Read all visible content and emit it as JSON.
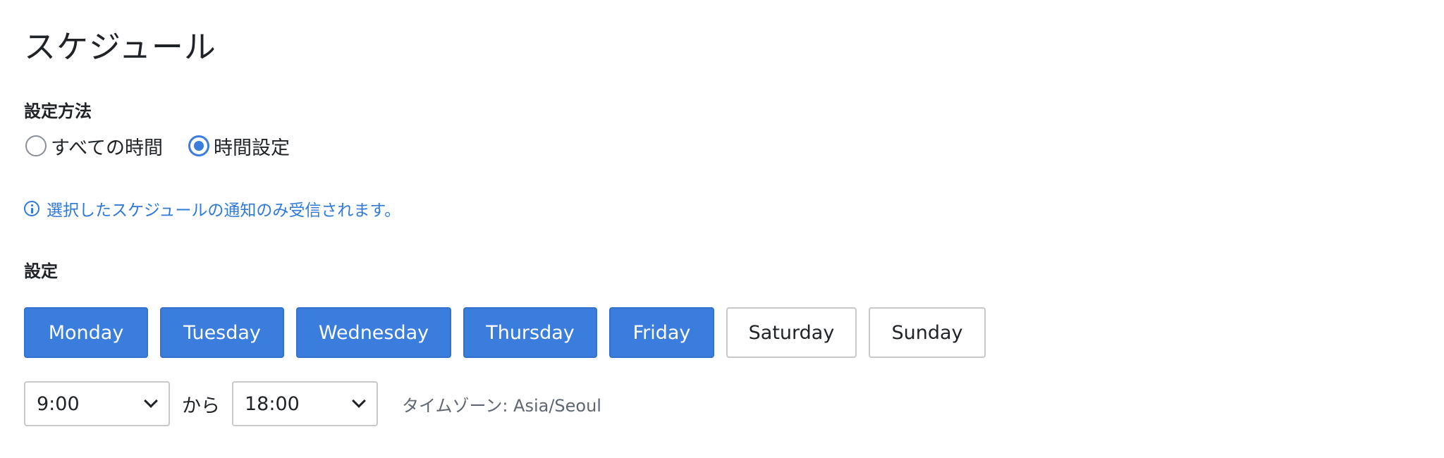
{
  "title": "スケジュール",
  "method": {
    "label": "設定方法",
    "options": [
      {
        "label": "すべての時間",
        "checked": false
      },
      {
        "label": "時間設定",
        "checked": true
      }
    ]
  },
  "info": {
    "icon": "info-icon",
    "text": "選択したスケジュールの通知のみ受信されます。"
  },
  "settings": {
    "label": "設定",
    "days": [
      {
        "label": "Monday",
        "selected": true
      },
      {
        "label": "Tuesday",
        "selected": true
      },
      {
        "label": "Wednesday",
        "selected": true
      },
      {
        "label": "Thursday",
        "selected": true
      },
      {
        "label": "Friday",
        "selected": true
      },
      {
        "label": "Saturday",
        "selected": false
      },
      {
        "label": "Sunday",
        "selected": false
      }
    ],
    "start_time": "9:00",
    "from_label": "から",
    "end_time": "18:00",
    "timezone": "タイムゾーン: Asia/Seoul"
  },
  "colors": {
    "accent": "#3b7ddd",
    "info_text": "#2f7ad8",
    "border": "#c7c9cd"
  }
}
